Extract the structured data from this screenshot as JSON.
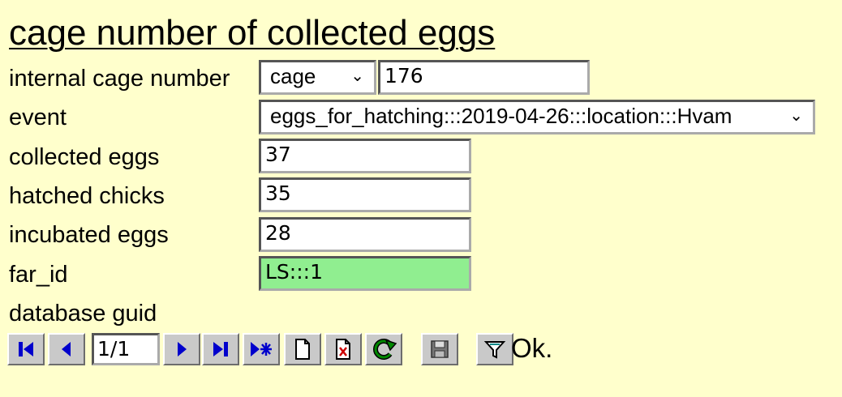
{
  "title": "cage number of collected eggs",
  "fields": {
    "internal_cage_number": {
      "label": "internal cage number",
      "selected_type": "cage",
      "value": "176"
    },
    "event": {
      "label": "event",
      "selected_value": "eggs_for_hatching:::2019-04-26:::location:::Hvam"
    },
    "collected_eggs": {
      "label": "collected eggs",
      "value": "37"
    },
    "hatched_chicks": {
      "label": "hatched chicks",
      "value": "35"
    },
    "incubated_eggs": {
      "label": "incubated eggs",
      "value": "28"
    },
    "far_id": {
      "label": "far_id",
      "value": "LS:::1"
    },
    "database_guid": {
      "label": "database guid"
    }
  },
  "toolbar": {
    "record_position": "1/1",
    "buttons": [
      "first-record-icon",
      "previous-record-icon",
      "next-record-icon",
      "last-record-icon",
      "new-record-icon",
      "new-document-icon",
      "delete-record-icon",
      "refresh-icon",
      "save-icon",
      "filter-icon"
    ]
  },
  "status": "Ok.",
  "colors": {
    "background": "#ffffcc",
    "highlight_field": "#90ee90",
    "nav_icon_blue": "#0000cc",
    "delete_red": "#cc0000",
    "refresh_green": "#008800"
  }
}
